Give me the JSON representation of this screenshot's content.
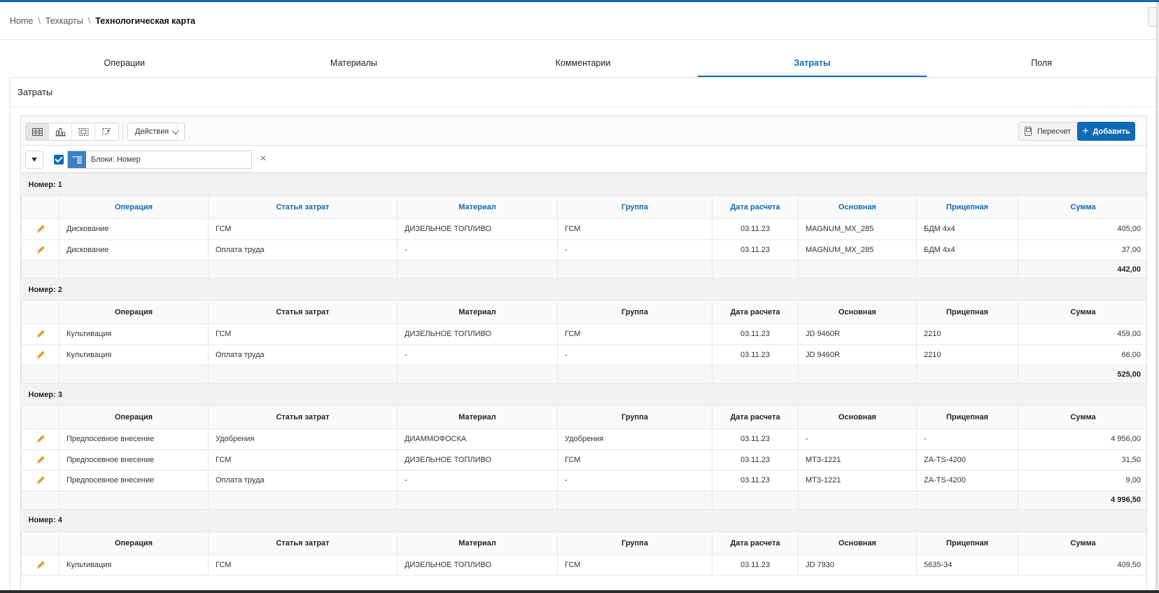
{
  "breadcrumb": {
    "items": [
      "Home",
      "Техкарты"
    ],
    "separator": "\\",
    "current": "Технологическая карта"
  },
  "tabs": [
    {
      "label": "Операции",
      "active": false
    },
    {
      "label": "Материалы",
      "active": false
    },
    {
      "label": "Комментарии",
      "active": false
    },
    {
      "label": "Затраты",
      "active": true
    },
    {
      "label": "Поля",
      "active": false
    }
  ],
  "panel": {
    "title": "Затраты"
  },
  "toolbar": {
    "views": [
      "grid-view-icon",
      "chart-view-icon",
      "group-by-view-icon",
      "pivot-view-icon"
    ],
    "actions_label": "Действия",
    "recalc_label": "Пересчет",
    "add_label": "Добавить"
  },
  "filter": {
    "label": "Блоки: Номер",
    "remove_symbol": "×"
  },
  "columns": [
    "Операция",
    "Статья затрат",
    "Материал",
    "Группа",
    "Дата расчета",
    "Основная",
    "Прицепная",
    "Сумма"
  ],
  "groups": [
    {
      "title": "Номер: 1",
      "rows": [
        [
          "Дискование",
          "ГСМ",
          "ДИЗЕЛЬНОЕ ТОПЛИВО",
          "ГСМ",
          "03.11.23",
          "MAGNUM_MX_285",
          "БДМ 4х4",
          "405,00"
        ],
        [
          "Дискование",
          "Оплата труда",
          "-",
          "-",
          "03.11.23",
          "MAGNUM_MX_285",
          "БДМ 4х4",
          "37,00"
        ]
      ],
      "total": "442,00"
    },
    {
      "title": "Номер: 2",
      "rows": [
        [
          "Культивация",
          "ГСМ",
          "ДИЗЕЛЬНОЕ ТОПЛИВО",
          "ГСМ",
          "03.11.23",
          "JD 9460R",
          "2210",
          "459,00"
        ],
        [
          "Культивация",
          "Оплата труда",
          "-",
          "-",
          "03.11.23",
          "JD 9460R",
          "2210",
          "66,00"
        ]
      ],
      "total": "525,00"
    },
    {
      "title": "Номер: 3",
      "rows": [
        [
          "Предпосевное внесение",
          "Удобрения",
          "ДИАММОФОСКА",
          "Удобрения",
          "03.11.23",
          "-",
          "-",
          "4 956,00"
        ],
        [
          "Предпосевное внесение",
          "ГСМ",
          "ДИЗЕЛЬНОЕ ТОПЛИВО",
          "ГСМ",
          "03.11.23",
          "МТЗ-1221",
          "ZA-TS-4200",
          "31,50"
        ],
        [
          "Предпосевное внесение",
          "Оплата труда",
          "-",
          "-",
          "03.11.23",
          "МТЗ-1221",
          "ZA-TS-4200",
          "9,00"
        ]
      ],
      "total": "4 996,50"
    },
    {
      "title": "Номер: 4",
      "rows": [
        [
          "Культивация",
          "ГСМ",
          "ДИЗЕЛЬНОЕ ТОПЛИВО",
          "ГСМ",
          "03.11.23",
          "JD 7930",
          "5635-34",
          "409,50"
        ]
      ],
      "total": null
    }
  ],
  "colors": {
    "accent": "#0f6ab4",
    "edit_icon": "#f0a020"
  }
}
